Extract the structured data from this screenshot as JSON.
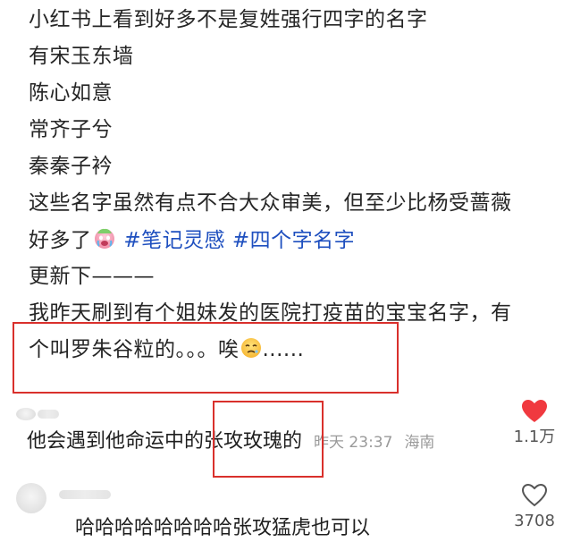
{
  "post": {
    "line1": "小红书上看到好多不是复姓强行四字的名字",
    "line2": "有宋玉东墙",
    "line3": "陈心如意",
    "line4": "常齐子兮",
    "line5": "秦秦子衿",
    "line6": "这些名字虽然有点不合大众审美，但至少比杨受蔷薇",
    "line7_text": "好多了",
    "tag1": "#笔记灵感",
    "tag2": "#四个字名字",
    "line8": "更新下———",
    "line9": "我昨天刷到有个姐妹发的医院打疫苗的宝宝名字，有",
    "line10_text": "个叫罗朱谷粒的。。。唉",
    "line10_ellipsis": "......"
  },
  "comments": [
    {
      "text_before": "他会遇到他命运中的",
      "text_highlight": "张攻玫瑰的",
      "time": "昨天 23:37",
      "location": "海南",
      "like_count": "1.1万",
      "liked": true
    },
    {
      "text": "哈哈哈哈哈哈哈哈张攻猛虎也可以",
      "like_count": "3708",
      "liked": false
    }
  ],
  "colors": {
    "accent_red": "#d9302c",
    "like_red": "#f0393f",
    "tag_blue": "#1e4fbf"
  }
}
